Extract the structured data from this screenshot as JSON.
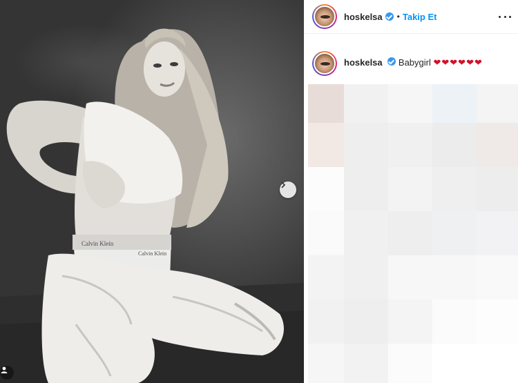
{
  "post": {
    "username": "hoskelsa",
    "verified": true,
    "separator": "•",
    "follow_label": "Takip Et",
    "more_icon": "more-horizontal-icon",
    "caption": {
      "username": "hoskelsa",
      "text": "Babygirl",
      "hearts": "❤❤❤❤❤❤"
    }
  },
  "media": {
    "photo_text": [
      "Calvin Klein",
      "Calvin Klein"
    ],
    "next_icon": "chevron-right-icon",
    "tag_icon": "user-tag-icon"
  },
  "colors": {
    "follow_blue": "#0095f6",
    "verified_blue": "#3897f0",
    "heart_red": "#d0102a",
    "text": "#262626"
  }
}
